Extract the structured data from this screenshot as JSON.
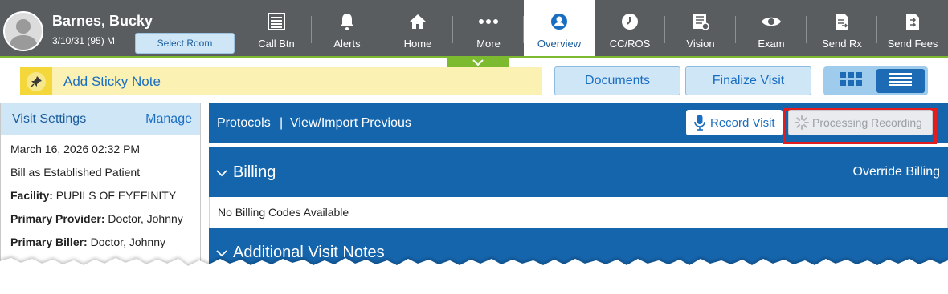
{
  "patient": {
    "name": "Barnes, Bucky",
    "dob_age_sex": "3/10/31 (95) M",
    "select_room_label": "Select Room"
  },
  "nav": [
    {
      "label": "Call Btn",
      "icon": "call-button-icon",
      "active": false
    },
    {
      "label": "Alerts",
      "icon": "bell-icon",
      "active": false
    },
    {
      "label": "Home",
      "icon": "home-icon",
      "active": false
    },
    {
      "label": "More",
      "icon": "more-dots-icon",
      "active": false
    },
    {
      "label": "Overview",
      "icon": "person-icon",
      "active": true
    },
    {
      "label": "CC/ROS",
      "icon": "clock-icon",
      "active": false
    },
    {
      "label": "Vision",
      "icon": "vision-chart-icon",
      "active": false
    },
    {
      "label": "Exam",
      "icon": "eye-icon",
      "active": false
    },
    {
      "label": "Send Rx",
      "icon": "send-rx-icon",
      "active": false
    },
    {
      "label": "Send Fees",
      "icon": "send-fees-icon",
      "active": false
    }
  ],
  "toolbar": {
    "sticky_note_label": "Add Sticky Note",
    "documents_label": "Documents",
    "finalize_label": "Finalize Visit"
  },
  "visit_settings": {
    "title": "Visit Settings",
    "manage_label": "Manage",
    "date": "March 16, 2026 02:32 PM",
    "billing_type": "Bill as Established Patient",
    "facility_label": "Facility:",
    "facility_value": "PUPILS OF EYEFINITY",
    "primary_provider_label": "Primary Provider:",
    "primary_provider_value": "Doctor, Johnny",
    "primary_biller_label": "Primary Biller:",
    "primary_biller_value": "Doctor, Johnny"
  },
  "protocols_bar": {
    "protocols_label": "Protocols",
    "separator": "|",
    "view_import_label": "View/Import Previous",
    "record_label": "Record Visit",
    "processing_label": "Processing Recording"
  },
  "billing": {
    "title": "Billing",
    "override_label": "Override Billing",
    "empty_message": "No Billing Codes Available"
  },
  "notes": {
    "title": "Additional Visit Notes"
  },
  "colors": {
    "topbar": "#5a5d60",
    "accent_blue": "#1565ad",
    "light_blue": "#cfe6f7",
    "sticky_yellow": "#fbf1b3",
    "green": "#7cbb2f",
    "highlight_red": "#e31d1d"
  }
}
